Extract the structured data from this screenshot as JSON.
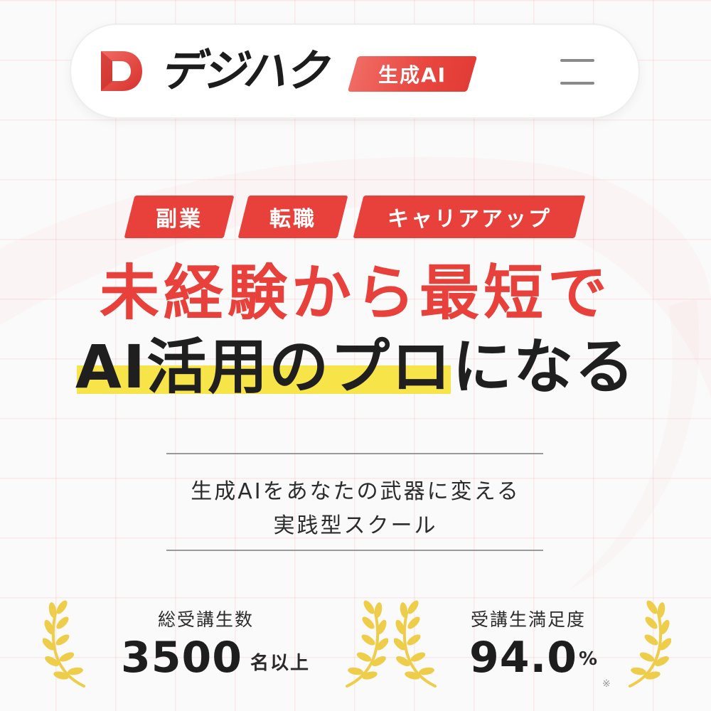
{
  "header": {
    "logo_text": "デジハク",
    "logo_badge": "生成AI",
    "logo_icon": "D-logo-icon",
    "menu_icon": "hamburger-menu-icon"
  },
  "tags": [
    "副業",
    "転職",
    "キャリアアップ"
  ],
  "hero": {
    "headline_line1": "未経験から最短で",
    "headline_line2": "AI活用のプロになる"
  },
  "tagline": {
    "line1": "生成AIをあなたの武器に変える",
    "line2": "実践型スクール"
  },
  "stats": [
    {
      "label": "総受講生数",
      "value": "3500",
      "unit": "名以上",
      "note": ""
    },
    {
      "label": "受講生満足度",
      "value": "94.0",
      "unit": "%",
      "note": "※"
    }
  ],
  "colors": {
    "brand_red": "#e8413b",
    "highlight_yellow": "#f7e448",
    "laurel_gold": "#edcd4a"
  }
}
